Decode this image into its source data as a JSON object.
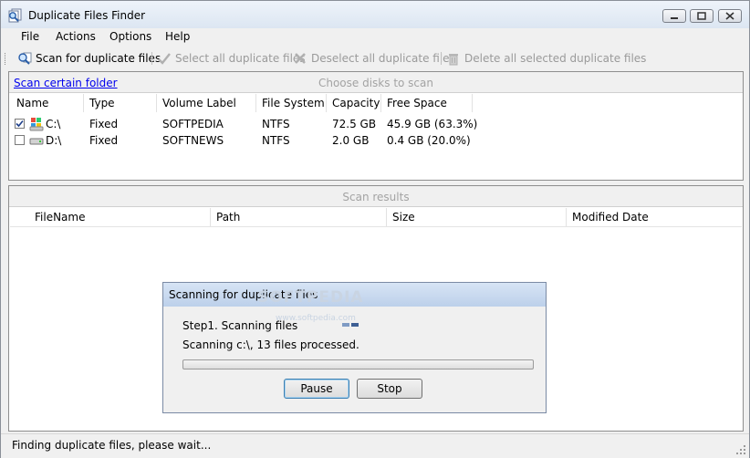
{
  "window": {
    "title": "Duplicate Files Finder"
  },
  "menu": {
    "file": "File",
    "actions": "Actions",
    "options": "Options",
    "help": "Help"
  },
  "toolbar": {
    "scan": "Scan for duplicate files",
    "select_all": "Select all duplicate files",
    "deselect_all": "Deselect all duplicate files",
    "delete_selected": "Delete all selected duplicate files"
  },
  "disks": {
    "scan_folder_link": "Scan certain folder",
    "header": "Choose disks to scan",
    "columns": [
      "Name",
      "Type",
      "Volume Label",
      "File System",
      "Capacity",
      "Free Space"
    ],
    "rows": [
      {
        "name": "C:\\",
        "type": "Fixed",
        "label": "SOFTPEDIA",
        "fs": "NTFS",
        "capacity": "72.5 GB",
        "free": "45.9 GB (63.3%)",
        "checked": true
      },
      {
        "name": "D:\\",
        "type": "Fixed",
        "label": "SOFTNEWS",
        "fs": "NTFS",
        "capacity": "2.0 GB",
        "free": "0.4 GB (20.0%)",
        "checked": false
      }
    ]
  },
  "results": {
    "header": "Scan results",
    "columns": [
      "FileName",
      "Path",
      "Size",
      "Modified Date"
    ]
  },
  "dialog": {
    "title": "Scanning for duplicate files",
    "step": "Step1. Scanning files",
    "status": "Scanning c:\\, 13 files processed.",
    "pause": "Pause",
    "stop": "Stop",
    "watermark": "SOFTPEDIA",
    "watermark_url": "www.softpedia.com"
  },
  "status": {
    "text": "Finding duplicate files, please wait..."
  },
  "icons": {
    "app": "magnifier-files-icon",
    "scan": "search-icon",
    "select": "checkmark-icon",
    "deselect": "x-icon",
    "delete": "trash-icon"
  }
}
